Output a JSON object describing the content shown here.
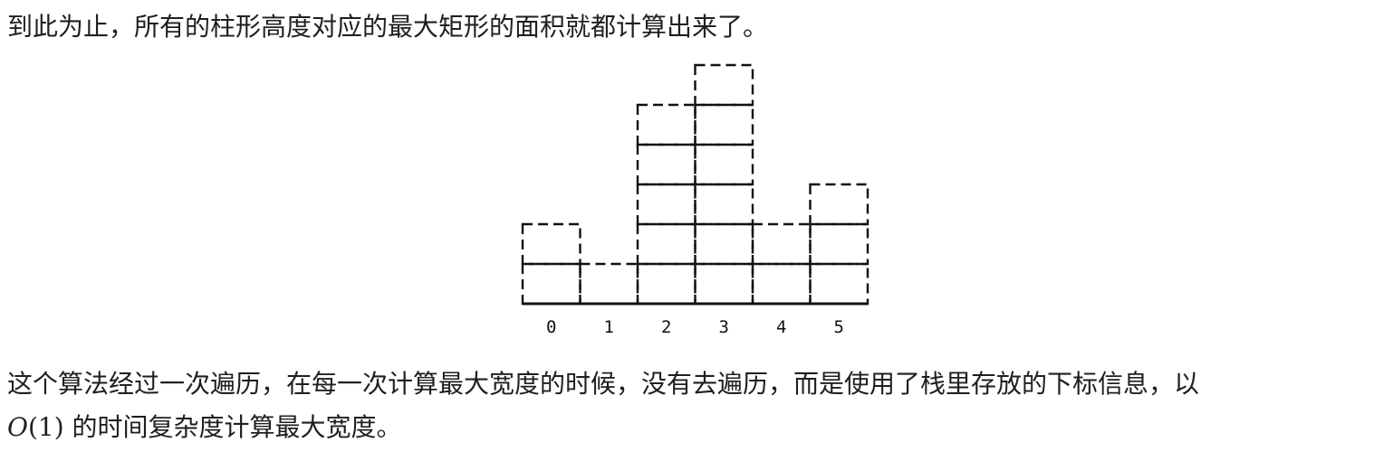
{
  "text": {
    "intro": "到此为止，所有的柱形高度对应的最大矩形的面积就都计算出来了。",
    "para2": "这个算法经过一次遍历，在每一次计算最大宽度的时候，没有去遍历，而是使用了栈里存放的下标信息，以",
    "para3_math_var": "O",
    "para3_math_arg": "(1)",
    "para3_rest": " 的时间复杂度计算最大宽度。"
  },
  "chart_data": {
    "type": "bar",
    "categories": [
      "0",
      "1",
      "2",
      "3",
      "4",
      "5"
    ],
    "values": [
      2,
      1,
      5,
      6,
      2,
      3
    ],
    "style": "dashed unit cells",
    "title": "",
    "xlabel": "",
    "ylabel": ""
  }
}
